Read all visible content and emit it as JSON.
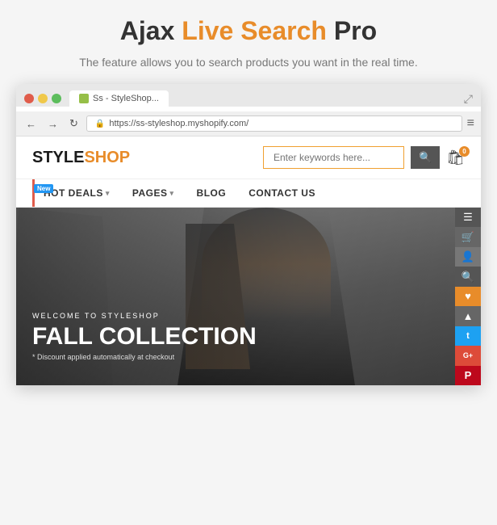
{
  "header": {
    "title_part1": "Ajax ",
    "title_part2": "Live Search",
    "title_part3": " Pro",
    "subtitle": "The feature allows you to search products you want in the real time."
  },
  "browser": {
    "tab_title": "Ss - StyleShop...",
    "url": "https://ss-styleshop.myshopify.com/",
    "favicon_color": "#96bf48"
  },
  "shop": {
    "logo_part1": "STYLE",
    "logo_part2": "SHOP",
    "search_placeholder": "Enter keywords here...",
    "cart_count": "0",
    "nav_items": [
      {
        "label": "HOT DEALS",
        "has_dropdown": true,
        "has_new": true
      },
      {
        "label": "PAGES",
        "has_dropdown": true,
        "has_new": false
      },
      {
        "label": "BLOG",
        "has_dropdown": false,
        "has_new": false
      },
      {
        "label": "CONTACT US",
        "has_dropdown": false,
        "has_new": false
      }
    ],
    "hero": {
      "subtitle": "WELCOME TO STYLESHOP",
      "title_line1": "FALL COLLECTION",
      "discount_text": "* Discount applied automatically at checkout"
    },
    "sidebar_icons": [
      {
        "name": "menu-icon",
        "symbol": "☰",
        "class": "dark1"
      },
      {
        "name": "cart-sidebar-icon",
        "symbol": "🛒",
        "class": "dark2"
      },
      {
        "name": "user-icon",
        "symbol": "👤",
        "class": "dark3"
      },
      {
        "name": "search-sidebar-icon",
        "symbol": "🔍",
        "class": "dark1"
      },
      {
        "name": "bookmark-icon",
        "symbol": "♥",
        "class": "orange"
      },
      {
        "name": "arrow-up-icon",
        "symbol": "▲",
        "class": "dark2"
      },
      {
        "name": "twitter-icon",
        "symbol": "𝕋",
        "class": "twitter"
      },
      {
        "name": "gplus-icon",
        "symbol": "G+",
        "class": "gplus"
      },
      {
        "name": "pinterest-icon",
        "symbol": "P",
        "class": "pinterest"
      }
    ]
  }
}
